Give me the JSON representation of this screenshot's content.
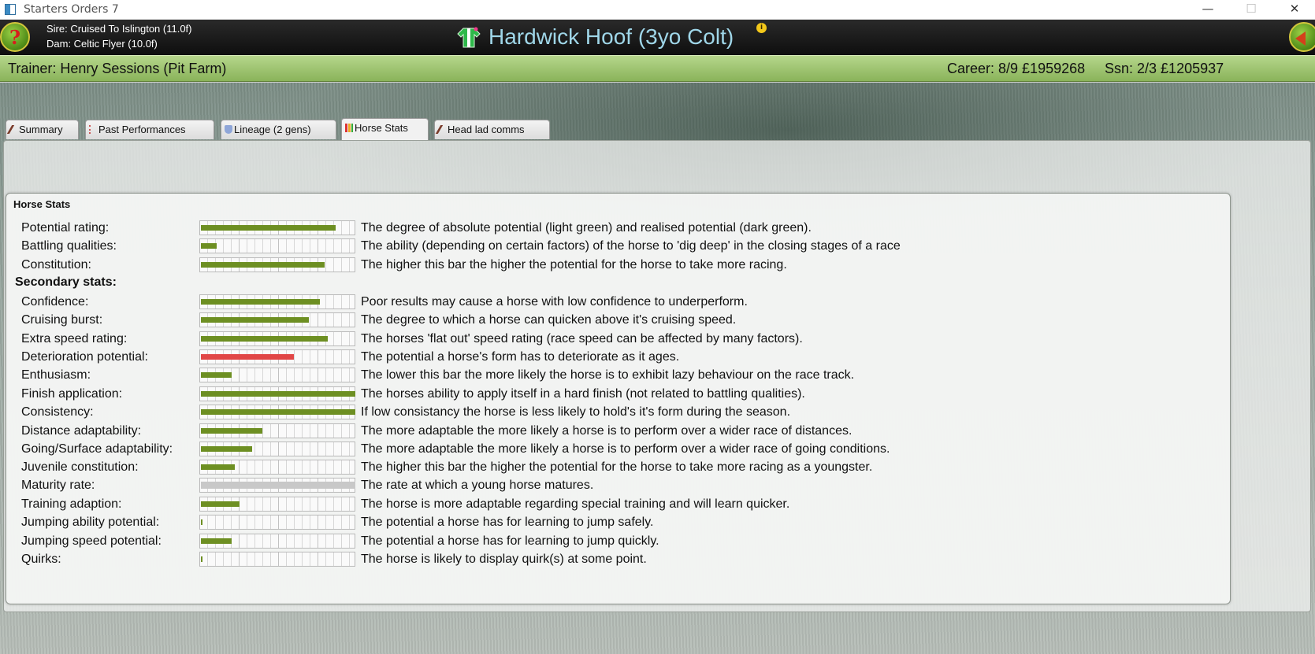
{
  "window": {
    "title": "Starters Orders 7"
  },
  "header": {
    "sire": "Sire: Cruised To Islington (11.0f)",
    "dam": "Dam: Celtic Flyer (10.0f)",
    "horse_name": "Hardwick Hoof (3yo Colt)",
    "help_label": "?"
  },
  "infobar": {
    "trainer": "Trainer: Henry Sessions  (Pit Farm)",
    "career": "Career: 8/9 £1959268",
    "season": "Ssn: 2/3 £1205937"
  },
  "tabs": [
    {
      "label": "Summary"
    },
    {
      "label": "Past Performances"
    },
    {
      "label": "Lineage (2 gens)"
    },
    {
      "label": "Horse Stats"
    },
    {
      "label": "Head lad comms"
    }
  ],
  "active_tab": "Horse Stats",
  "stats": {
    "heading": "Horse Stats",
    "secondary_heading": "Secondary stats:",
    "primary": [
      {
        "label": "Potential rating:",
        "value": 0.87,
        "color": "#6d8f22",
        "desc": "The degree of absolute potential (light green) and realised potential (dark green)."
      },
      {
        "label": "Battling qualities:",
        "value": 0.1,
        "color": "#6d8f22",
        "desc": "The ability (depending on certain factors) of the horse to 'dig deep' in the closing stages of a race"
      },
      {
        "label": "Constitution:",
        "value": 0.8,
        "color": "#6d8f22",
        "desc": "The higher this bar the higher the potential for the horse to take more racing."
      }
    ],
    "secondary": [
      {
        "label": "Confidence:",
        "value": 0.77,
        "color": "#6d8f22",
        "desc": "Poor results may cause a horse with low confidence to underperform."
      },
      {
        "label": "Cruising burst:",
        "value": 0.7,
        "color": "#6d8f22",
        "desc": "The degree to which a horse can quicken above it's cruising speed."
      },
      {
        "label": "Extra speed rating:",
        "value": 0.82,
        "color": "#6d8f22",
        "desc": "The horses 'flat out' speed rating (race speed can be affected by many factors)."
      },
      {
        "label": "Deterioration potential:",
        "value": 0.6,
        "color": "#e14646",
        "desc": "The potential a horse's form has to deteriorate as it ages."
      },
      {
        "label": "Enthusiasm:",
        "value": 0.2,
        "color": "#6d8f22",
        "desc": "The lower this bar the more likely the horse is to exhibit lazy behaviour on the race track."
      },
      {
        "label": "Finish application:",
        "value": 1.0,
        "color": "#6d8f22",
        "desc": "The horses ability to apply itself in a hard finish (not related to battling qualities)."
      },
      {
        "label": "Consistency:",
        "value": 1.0,
        "color": "#6d8f22",
        "desc": "If low consistancy the horse is less likely to hold's it's form during the season."
      },
      {
        "label": "Distance adaptability:",
        "value": 0.4,
        "color": "#6d8f22",
        "desc": "The more adaptable the more likely a horse is to perform over a wider race of distances."
      },
      {
        "label": "Going/Surface adaptability:",
        "value": 0.33,
        "color": "#6d8f22",
        "desc": "The more adaptable the more likely a horse is to perform over a wider race of going conditions."
      },
      {
        "label": "Juvenile constitution:",
        "value": 0.22,
        "color": "#6d8f22",
        "desc": "The higher this bar the higher the potential for the horse to take more racing as a youngster."
      },
      {
        "label": "Maturity rate:",
        "value": 1.0,
        "color": "#c8c8c8",
        "desc": "The rate at which a young horse matures."
      },
      {
        "label": "Training adaption:",
        "value": 0.25,
        "color": "#6d8f22",
        "desc": "The horse is more adaptable regarding special training and will learn quicker."
      },
      {
        "label": "Jumping ability potential:",
        "value": 0.01,
        "color": "#6d8f22",
        "desc": "The potential a horse has for learning to jump safely."
      },
      {
        "label": "Jumping speed potential:",
        "value": 0.2,
        "color": "#6d8f22",
        "desc": "The potential a horse has for learning to jump quickly."
      },
      {
        "label": "Quirks:",
        "value": 0.01,
        "color": "#6d8f22",
        "desc": "The horse is likely to display quirk(s) at some point."
      }
    ]
  }
}
